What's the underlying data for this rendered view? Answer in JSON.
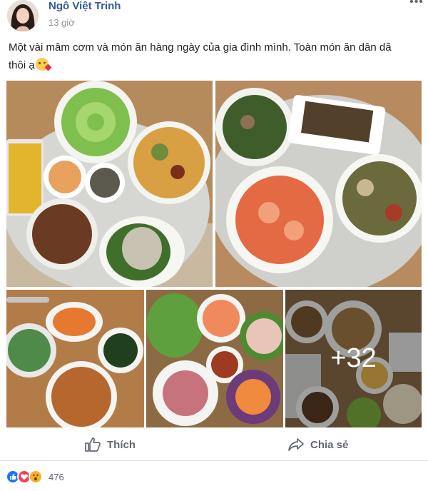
{
  "post": {
    "author": "Ngô Việt Trinh",
    "time": "13 giờ",
    "text": "Một vài mâm cơm và món ăn hàng ngày của gia đình mình. Toàn món ăn dân dã thôi ạ"
  },
  "photos": {
    "more_count": "+32"
  },
  "actions": {
    "like_label": "Thích",
    "share_label": "Chia sẻ"
  },
  "reactions": {
    "count": "476",
    "types": [
      "like-icon",
      "love-icon",
      "wow-icon"
    ]
  },
  "colors": {
    "author": "#385898",
    "action_text": "#606770",
    "like_blue": "#1877f2",
    "love_red": "#f33e58",
    "wow_yellow": "#f7b125"
  }
}
